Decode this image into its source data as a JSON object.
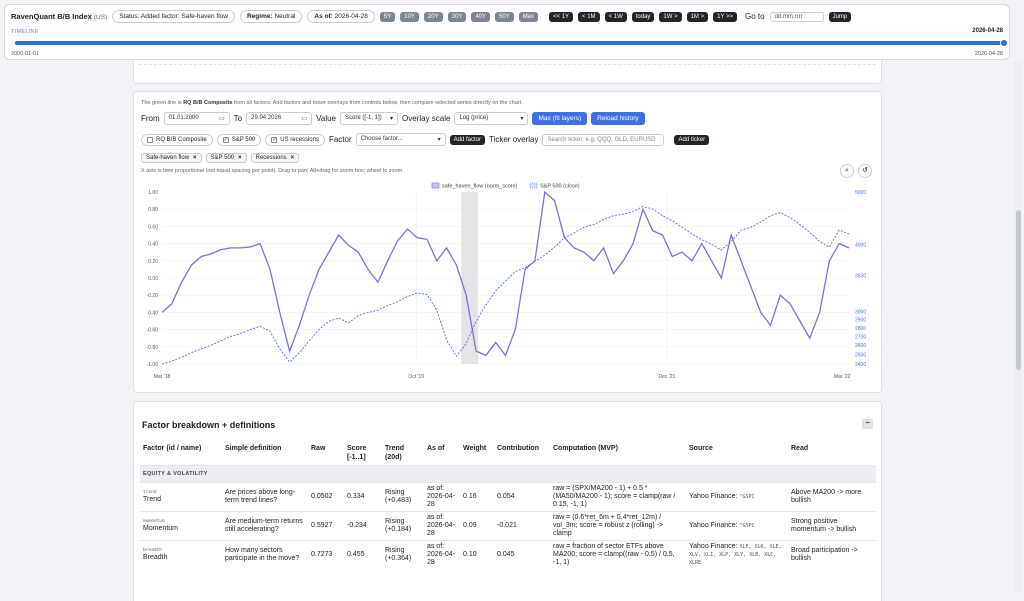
{
  "header": {
    "title": "RavenQuant B/B Index",
    "country": "(US)",
    "status": "Status: Added factor: Safe-haven flow",
    "regime_label": "Regime:",
    "regime_value": "Neutral",
    "asof_label": "As of:",
    "asof_value": "2026-04-28",
    "range_buttons": [
      "5Y",
      "10Y",
      "20Y",
      "30Y",
      "40Y",
      "50Y",
      "Max"
    ],
    "step_buttons": [
      "<< 1Y",
      "< 1M",
      "< 1W",
      "today",
      "1W >",
      "1M >",
      "1Y >>"
    ],
    "goto_label": "Go to",
    "goto_placeholder": "dd.mm.rrrr",
    "jump_label": "Jump"
  },
  "timeline": {
    "label": "TIMELINE",
    "current": "2026-04-28",
    "start": "2000-01-01",
    "end": "2026-04-28",
    "position_fraction": 1.0
  },
  "chart_panel": {
    "note_prefix": "The green line is",
    "note_bold": "RQ B/B Composite",
    "note_suffix": "from all factors. Add factors and ticker overlays from controls below, then compare selected series directly on the chart.",
    "from_label": "From",
    "from_value": "01.01.2000",
    "to_label": "To",
    "to_value": "29.04.2026",
    "value_label": "Value",
    "value_select": "Score ([-1, 1])",
    "overlay_label": "Overlay scale",
    "overlay_select": "Log (price)",
    "max_btn": "Max (fit layers)",
    "reload_btn": "Reload history",
    "toggles": [
      {
        "label": "RQ B/B Composite",
        "checked": false
      },
      {
        "label": "S&P 500",
        "checked": true
      },
      {
        "label": "US recessions",
        "checked": true
      }
    ],
    "factor_label": "Factor",
    "factor_placeholder": "Choose factor...",
    "add_factor": "Add factor",
    "ticker_label": "Ticker overlay",
    "ticker_placeholder": "Search ticker, e.g. QQQ, GLD, EURUSD",
    "add_ticker": "Add ticker",
    "chips": [
      "Safe-haven flow",
      "S&P 500",
      "Recessions"
    ],
    "axis_note": "X axis is time proportional (not equal spacing per point). Drag to pan; Alt+drag for zoom box; wheel to zoom.",
    "zoom_icon": "magnifier-icon",
    "reset_icon": "reset-icon"
  },
  "chart_data": {
    "type": "line",
    "legend": [
      "safe_haven_flow (norm_score)",
      "S&P 500 (close)"
    ],
    "legend_position": "top-center",
    "x_ticks": [
      "Mar '18",
      "Oct '19",
      "Dec '21",
      "Mar '22"
    ],
    "x_range": [
      "2017-05",
      "2024-03"
    ],
    "y_left_ticks": [
      "1.00",
      "0.80",
      "0.60",
      "0.40",
      "0.20",
      "0.00",
      "-0.20",
      "-0.40",
      "-0.60",
      "-0.80",
      "-1.00"
    ],
    "y_left_range": [
      -1.0,
      1.0
    ],
    "y_right_ticks": [
      "5000",
      "4000",
      "3500",
      "3000",
      "2900",
      "2800",
      "2700",
      "2600",
      "2500",
      "2400"
    ],
    "y_right_scale": "log",
    "colors": {
      "primary": "#7b72d8",
      "secondary": "#4a6fe0",
      "recession": "#d8d8dc"
    },
    "recession_band": [
      "2020-02",
      "2020-04"
    ],
    "series": [
      {
        "name": "safe_haven_flow (norm_score)",
        "style": "solid",
        "values": [
          -0.4,
          -0.3,
          -0.05,
          0.15,
          0.25,
          0.28,
          0.33,
          0.35,
          0.35,
          0.36,
          0.4,
          0.1,
          -0.4,
          -0.85,
          -0.55,
          -0.2,
          0.1,
          0.3,
          0.5,
          0.38,
          0.3,
          0.1,
          -0.05,
          0.2,
          0.43,
          0.57,
          0.47,
          0.45,
          0.2,
          0.35,
          0.15,
          -0.2,
          -0.85,
          -0.9,
          -0.75,
          -0.9,
          -0.6,
          0.1,
          0.2,
          1.0,
          0.9,
          0.47,
          0.35,
          0.3,
          0.2,
          0.35,
          0.05,
          0.2,
          0.4,
          0.8,
          0.55,
          0.5,
          0.25,
          0.3,
          0.2,
          0.4,
          0.2,
          0.0,
          0.5,
          0.2,
          -0.1,
          -0.4,
          -0.55,
          -0.2,
          -0.3,
          -0.5,
          -0.7,
          -0.4,
          0.2,
          0.4,
          0.35
        ]
      },
      {
        "name": "S&P 500 (close)",
        "style": "dashed",
        "values": [
          2400,
          2430,
          2470,
          2520,
          2560,
          2600,
          2650,
          2700,
          2730,
          2780,
          2820,
          2760,
          2560,
          2420,
          2520,
          2650,
          2780,
          2880,
          2920,
          2860,
          2950,
          2990,
          3020,
          3080,
          3130,
          3200,
          3250,
          3230,
          3020,
          2660,
          2480,
          2620,
          2880,
          3090,
          3280,
          3420,
          3560,
          3620,
          3720,
          3820,
          3950,
          4110,
          4200,
          4300,
          4350,
          4450,
          4520,
          4550,
          4600,
          4700,
          4650,
          4520,
          4420,
          4300,
          4180,
          4080,
          4000,
          3900,
          4050,
          4250,
          4300,
          4400,
          4520,
          4580,
          4480,
          4350,
          4210,
          4050,
          3950,
          4250,
          4180
        ]
      }
    ]
  },
  "factor_table": {
    "title": "Factor breakdown + definitions",
    "collapse_label": "−",
    "columns": [
      "Factor (id / name)",
      "Simple definition",
      "Raw",
      "Score [-1..1]",
      "Trend (20d)",
      "As of",
      "Weight",
      "Contribution",
      "Computation (MVP)",
      "Source",
      "Read"
    ],
    "group": "EQUITY & VOLATILITY",
    "rows": [
      {
        "id": "trend",
        "name": "Trend",
        "definition": "Are prices above long-term trend lines?",
        "raw": "0.0502",
        "score": "0.334",
        "trend": "Rising (+0.483)",
        "asof": "as of: 2026-04-28",
        "weight": "0.16",
        "contribution": "0.054",
        "computation": "raw = (SPX/MA200 - 1) + 0.5 * (MA50/MA200 - 1); score = clamp(raw / 0.15, -1, 1)",
        "source": "Yahoo Finance:",
        "source_code": "^GSPC",
        "read": "Above MA200 -> more bullish"
      },
      {
        "id": "momentum",
        "name": "Momentum",
        "definition": "Are medium-term returns still accelerating?",
        "raw": "0.5927",
        "score": "-0.234",
        "trend": "Rising (+0.184)",
        "asof": "as of: 2026-04-28",
        "weight": "0.09",
        "contribution": "-0.021",
        "computation": "raw = (0.6*ret_6m + 0.4*ret_12m) / vol_3m; score = robust z (rolling) -> clamp",
        "source": "Yahoo Finance:",
        "source_code": "^GSPC",
        "read": "Strong positive momentum -> bullish"
      },
      {
        "id": "breadth",
        "name": "Breadth",
        "definition": "How many sectors participate in the move?",
        "raw": "0.7273",
        "score": "0.455",
        "trend": "Rising (+0.364)",
        "asof": "as of: 2026-04-28",
        "weight": "0.10",
        "contribution": "0.045",
        "computation": "raw = fraction of sector ETFs above MA200; score = clamp((raw - 0.5) / 0.5, -1, 1)",
        "source": "Yahoo Finance:",
        "source_code": "XLF, XLK, XLE, XLV, XLI, XLP, XLY, XLB, XLC, XLRE",
        "read": "Broad participation -> bullish"
      }
    ]
  }
}
